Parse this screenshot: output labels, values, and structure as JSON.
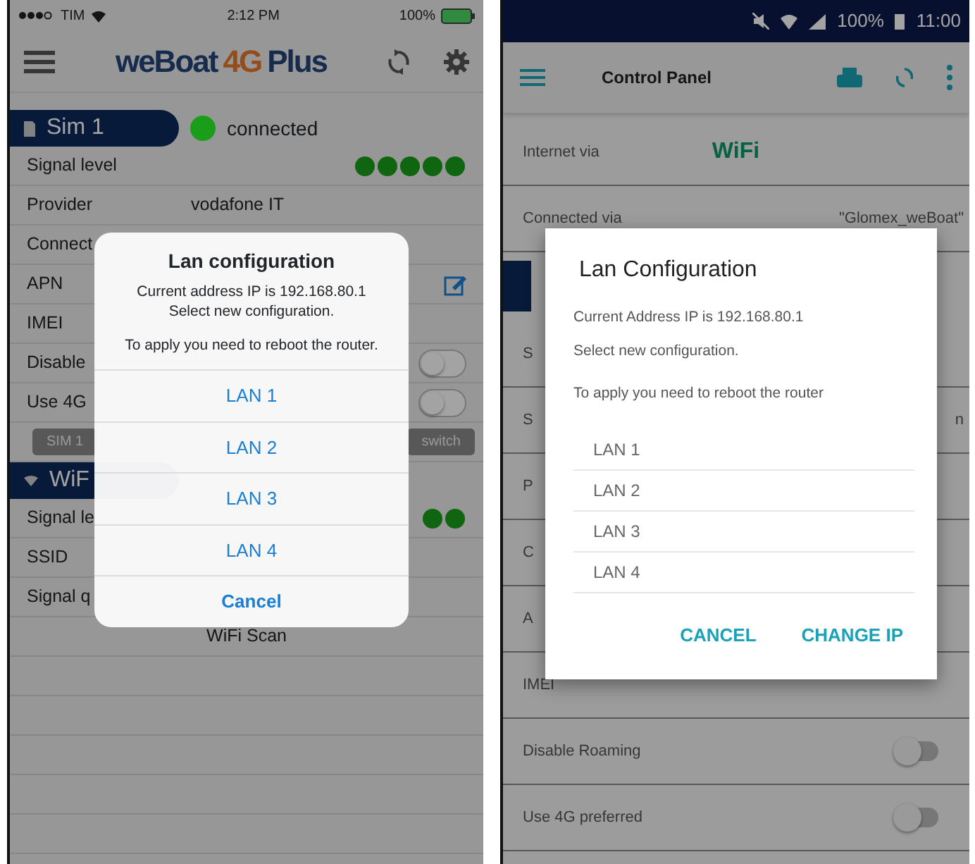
{
  "left_phone": {
    "status_bar": {
      "carrier": "TIM",
      "time": "2:12 PM",
      "battery": "100%"
    },
    "app_bar": {
      "logo": {
        "word": "weBoat",
        "model": "4G",
        "edition": "Plus"
      }
    },
    "sim_header": {
      "label": "Sim 1",
      "status": "connected",
      "color": "#1a9e1a"
    },
    "sim_rows": [
      {
        "kind": "signal",
        "label": "Signal level"
      },
      {
        "kind": "text",
        "label": "Provider",
        "value": "vodafone IT"
      },
      {
        "kind": "text",
        "label": "Connect"
      },
      {
        "kind": "edit",
        "label": "APN"
      },
      {
        "kind": "text",
        "label": "IMEI"
      },
      {
        "kind": "toggle",
        "label": "Disable",
        "on": false
      },
      {
        "kind": "toggle",
        "label": "Use 4G",
        "on": false
      }
    ],
    "sim_buttons": [
      "SIM 1",
      "switch"
    ],
    "wifi_header": {
      "label": "WiF"
    },
    "wifi_rows": [
      {
        "kind": "signal",
        "label": "Signal le"
      },
      {
        "kind": "text",
        "label": "SSID"
      },
      {
        "kind": "text",
        "label": "Signal q"
      }
    ],
    "wifi_scan": "WiFi Scan",
    "dialog": {
      "title": "Lan configuration",
      "message": [
        "Current address IP is 192.168.80.1",
        "Select new configuration."
      ],
      "note": "To apply you need to reboot the router.",
      "options": [
        "LAN 1",
        "LAN 2",
        "LAN 3",
        "LAN 4"
      ],
      "cancel": "Cancel"
    }
  },
  "right_phone": {
    "status_bar": {
      "battery": "100%",
      "time": "11:00"
    },
    "app_bar": {
      "title": "Control Panel"
    },
    "rows": [
      {
        "kind": "highlight",
        "label": "Internet via",
        "value": "WiFi"
      },
      {
        "kind": "text",
        "label": "Connected via",
        "value": "\"Glomex_weBoat\""
      },
      {
        "kind": "header"
      },
      {
        "kind": "text",
        "label": "S"
      },
      {
        "kind": "text",
        "label": "S",
        "value": "n"
      },
      {
        "kind": "text",
        "label": "P"
      },
      {
        "kind": "text",
        "label": "C"
      },
      {
        "kind": "text",
        "label": "A"
      },
      {
        "kind": "text",
        "label": "IMEI"
      },
      {
        "kind": "toggle",
        "label": "Disable Roaming",
        "on": false
      },
      {
        "kind": "toggle",
        "label": "Use 4G preferred",
        "on": false
      }
    ],
    "dialog": {
      "title": "Lan Configuration",
      "message": [
        "Current Address IP is 192.168.80.1",
        "Select new configuration."
      ],
      "note": "To apply you need to reboot the router",
      "options": [
        "LAN 1",
        "LAN 2",
        "LAN 3",
        "LAN 4"
      ],
      "actions": [
        "CANCEL",
        "CHANGE IP"
      ]
    }
  }
}
